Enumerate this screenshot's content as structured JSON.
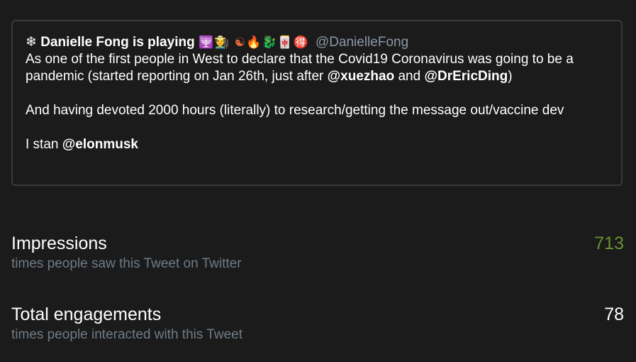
{
  "tweet": {
    "prefix_icon": "❄",
    "author_name": "Danielle Fong is playing",
    "author_emoji": "🕎🧑‍🌾 ☯🔥🐉🀄🉐",
    "handle": "@DanielleFong",
    "para1_a": "As one of the first people in West to declare that the Covid19 Coronavirus was going to be a pandemic (started reporting on Jan 26th, just after ",
    "mention1": "@xuezhao",
    "para1_b": " and ",
    "mention2": "@DrEricDing",
    "para1_c": ")",
    "para2": "And having devoted 2000 hours (literally) to research/getting the message out/vaccine dev",
    "para3_a": "I stan ",
    "mention3": "@elonmusk"
  },
  "metrics": {
    "impressions": {
      "title": "Impressions",
      "subtitle": "times people saw this Tweet on Twitter",
      "value": "713",
      "value_color": "#6a8f2f"
    },
    "engagements": {
      "title": "Total engagements",
      "subtitle": "times people interacted with this Tweet",
      "value": "78",
      "value_color": "#ffffff"
    }
  }
}
